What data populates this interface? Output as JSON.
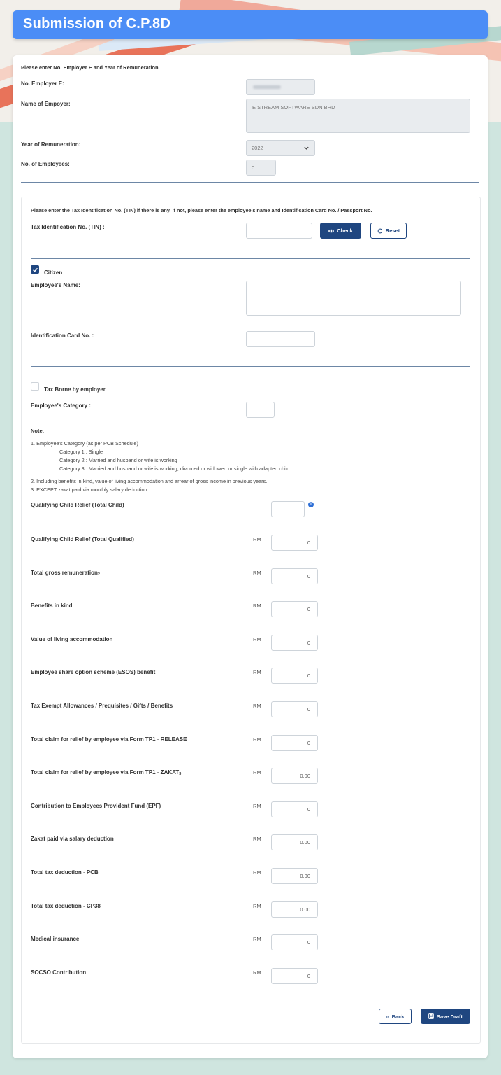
{
  "page": {
    "title": "Submission of C.P.8D"
  },
  "employer": {
    "intro": "Please enter No. Employer E and Year of Remuneration",
    "no_label": "No. Employer E:",
    "no_value": "",
    "name_label": "Name of Empoyer:",
    "name_value": "E STREAM SOFTWARE SDN BHD",
    "year_label": "Year of Remuneration:",
    "year_value": "2022",
    "count_label": "No. of Employees:",
    "count_value": "0"
  },
  "employee": {
    "tin_intro": "Please enter the Tax Identification No. (TIN) if there is any. If not, please enter the employee's name and Identification Card No. / Passport No.",
    "tin_label": "Tax Identification No. (TIN) :",
    "check_label": "Check",
    "reset_label": "Reset",
    "citizen_label": "Citizen",
    "citizen_checked": true,
    "name_label": "Employee's Name:",
    "ic_label": "Identification Card No. :",
    "tax_borne_label": "Tax Borne by employer",
    "tax_borne_checked": false,
    "category_label": "Employee's Category :"
  },
  "notes": {
    "title": "Note:",
    "n1": "1. Employee's Category (as per PCB Schedule)",
    "cat1": "Category 1 : Single",
    "cat2": "Category 2 : Married and husband or wife is working",
    "cat3": "Category 3 : Married and husband or wife is working, divorced or widowed or single with adapted child",
    "n2": "2. Including benefits in kind, value of living accommodation and arrear of gross income in previous years.",
    "n3": "3. EXCEPT zakat paid via monthly salary deduction"
  },
  "child_total": {
    "label": "Qualifying Child Relief (Total Child)",
    "value": ""
  },
  "currency": "RM",
  "rows": [
    {
      "label": "Qualifying Child Relief (Total Qualified)",
      "sub": "",
      "value": "0"
    },
    {
      "label": "Total gross remuneration",
      "sub": "2",
      "value": "0"
    },
    {
      "label": "Benefits in kind",
      "sub": "",
      "value": "0"
    },
    {
      "label": "Value of living accommodation",
      "sub": "",
      "value": "0"
    },
    {
      "label": "Employee share option scheme (ESOS) benefit",
      "sub": "",
      "value": "0"
    },
    {
      "label": "Tax Exempt Allowances / Prequisites / Gifts / Benefits",
      "sub": "",
      "value": "0"
    },
    {
      "label": "Total claim for relief by employee via Form TP1 - RELEASE",
      "sub": "",
      "value": "0"
    },
    {
      "label": "Total claim for relief by employee via Form TP1 - ZAKAT",
      "sub": "3",
      "value": "0.00"
    },
    {
      "label": "Contribution to Employees Provident Fund (EPF)",
      "sub": "",
      "value": "0"
    },
    {
      "label": "Zakat paid via salary deduction",
      "sub": "",
      "value": "0.00"
    },
    {
      "label": "Total tax deduction - PCB",
      "sub": "",
      "value": "0.00"
    },
    {
      "label": "Total tax deduction - CP38",
      "sub": "",
      "value": "0.00"
    },
    {
      "label": "Medical insurance",
      "sub": "",
      "value": "0"
    },
    {
      "label": "SOCSO Contribution",
      "sub": "",
      "value": "0"
    }
  ],
  "actions": {
    "back_label": "Back",
    "save_label": "Save Draft"
  },
  "colors": {
    "header": "#4b8df6",
    "primary": "#1f4680",
    "background": "#cfe5df"
  }
}
